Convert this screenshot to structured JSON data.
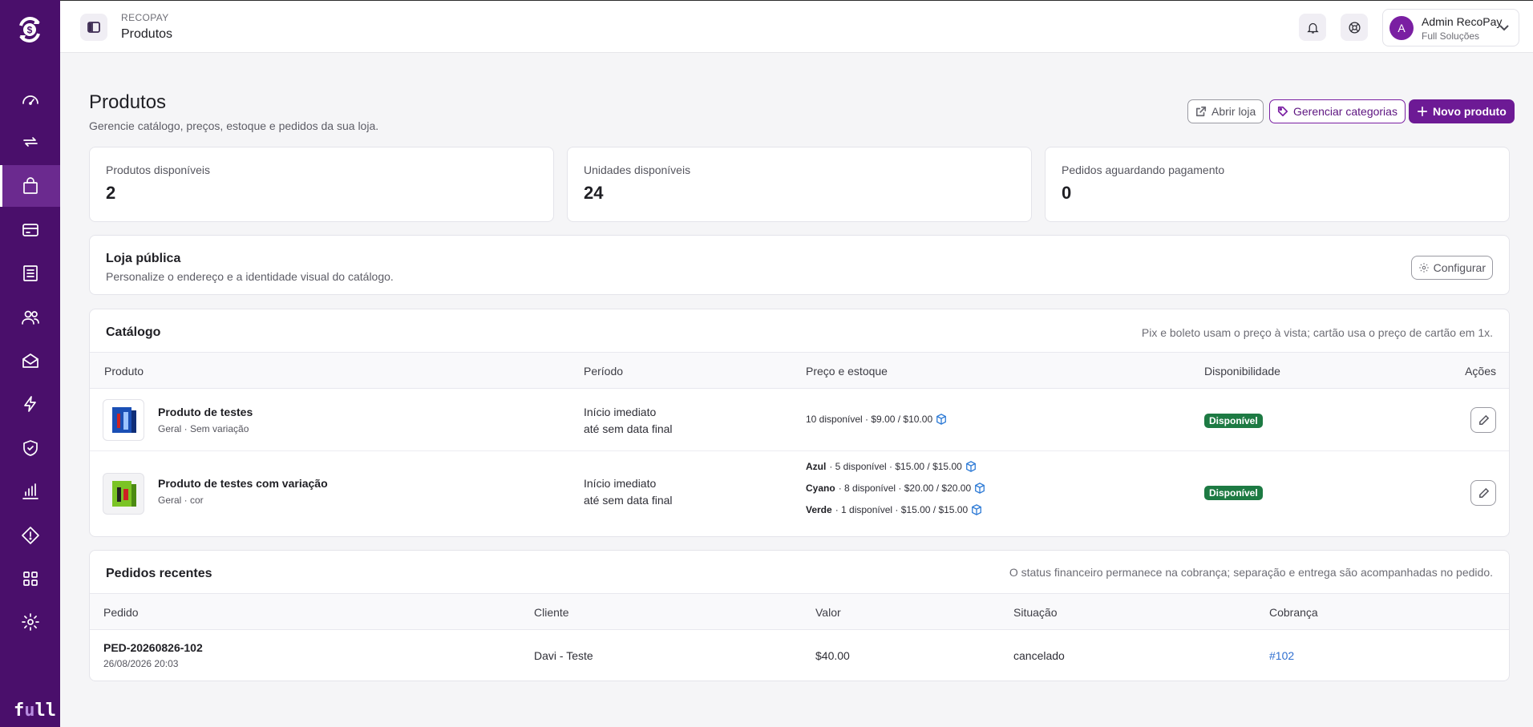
{
  "header": {
    "crumb_top": "RECOPAY",
    "crumb_title": "Produtos",
    "user_initial": "A",
    "user_name": "Admin RecoPay",
    "user_org": "Full Soluções"
  },
  "sidebar": {
    "items": [
      "dashboard-icon",
      "recurrence-icon",
      "shopping-bag-icon",
      "credit-card-icon",
      "receipt-icon",
      "users-icon",
      "mail-icon",
      "lightning-icon",
      "shield-icon",
      "bar-chart-icon",
      "alert-icon",
      "grid-icon",
      "gear-icon"
    ],
    "active": "shopping-bag-icon",
    "brand": [
      "f",
      "u",
      "l",
      "l"
    ]
  },
  "page": {
    "title": "Produtos",
    "subtitle": "Gerencie catálogo, preços, estoque e pedidos da sua loja.",
    "btn_abrir_loja": "Abrir loja",
    "btn_gerenciar_categorias": "Gerenciar categorias",
    "btn_novo_produto": "Novo produto"
  },
  "stats": [
    {
      "label": "Produtos disponíveis",
      "value": "2"
    },
    {
      "label": "Unidades disponíveis",
      "value": "24"
    },
    {
      "label": "Pedidos aguardando pagamento",
      "value": "0"
    }
  ],
  "loja": {
    "title": "Loja pública",
    "subtitle": "Personalize o endereço e a identidade visual do catálogo.",
    "button": "Configurar"
  },
  "catalog": {
    "title": "Catálogo",
    "note": "Pix e boleto usam o preço à vista; cartão usa o preço de cartão em 1x.",
    "columns": [
      "Produto",
      "Período",
      "Preço e estoque",
      "Disponibilidade",
      "Ações"
    ],
    "rows": [
      {
        "name": "Produto de testes",
        "meta": "Geral · Sem variação",
        "period_start": "Início imediato",
        "period_end": "até sem data final",
        "stock": [
          {
            "variant": "",
            "text": "10 disponível · $9.00 / $10.00"
          }
        ],
        "status": "Disponível"
      },
      {
        "name": "Produto de testes com variação",
        "meta": "Geral · cor",
        "period_start": "Início imediato",
        "period_end": "até sem data final",
        "stock": [
          {
            "variant": "Azul",
            "text": " · 5 disponível · $15.00 / $15.00"
          },
          {
            "variant": "Cyano",
            "text": " · 8 disponível · $20.00 / $20.00"
          },
          {
            "variant": "Verde",
            "text": " · 1 disponível · $15.00 / $15.00"
          }
        ],
        "status": "Disponível"
      }
    ]
  },
  "orders": {
    "title": "Pedidos recentes",
    "note": "O status financeiro permanece na cobrança; separação e entrega são acompanhadas no pedido.",
    "columns": [
      "Pedido",
      "Cliente",
      "Valor",
      "Situação",
      "Cobrança"
    ],
    "rows": [
      {
        "id": "PED-20260826-102",
        "date": "26/08/2026 20:03",
        "client": "Davi - Teste",
        "value": "$40.00",
        "status": "cancelado",
        "charge": "#102"
      }
    ]
  },
  "colors": {
    "sidebar": "#4a0f6b",
    "primary": "#6d1a95",
    "badge_green": "#1d7a43",
    "link": "#2f6fd0"
  }
}
